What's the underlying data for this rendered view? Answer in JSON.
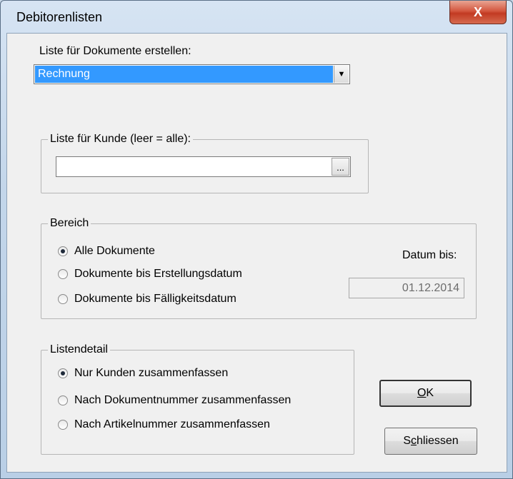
{
  "window": {
    "title": "Debitorenlisten",
    "close_glyph": "X"
  },
  "documents": {
    "label": "Liste für Dokumente erstellen:",
    "selected": "Rechnung",
    "arrow_glyph": "▼"
  },
  "customer": {
    "legend": "Liste für Kunde (leer = alle):",
    "value": "",
    "browse_glyph": "..."
  },
  "range": {
    "legend": "Bereich",
    "options": [
      "Alle Dokumente",
      "Dokumente bis Erstellungsdatum",
      "Dokumente bis Fälligkeitsdatum"
    ],
    "date_label": "Datum bis:",
    "date_value": "01.12.2014"
  },
  "detail": {
    "legend": "Listendetail",
    "options": [
      "Nur Kunden zusammenfassen",
      "Nach Dokumentnummer zusammenfassen",
      "Nach Artikelnummer zusammenfassen"
    ]
  },
  "buttons": {
    "ok_mnemonic": "O",
    "ok_rest": "K",
    "close_pre": "S",
    "close_mnemonic": "c",
    "close_rest": "hliessen"
  },
  "colors": {
    "selection": "#3399ff",
    "close_button": "#c7402a"
  }
}
